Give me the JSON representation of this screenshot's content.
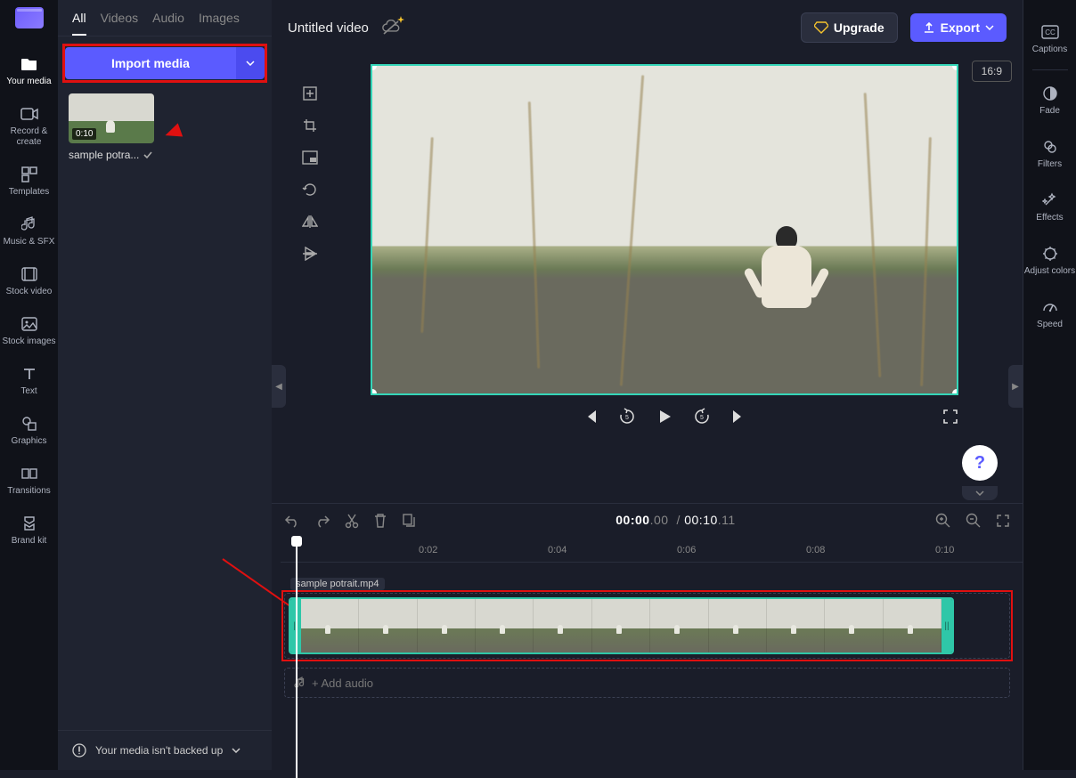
{
  "app": {
    "title": "Untitled video"
  },
  "leftRail": {
    "items": [
      {
        "label": "Your media"
      },
      {
        "label": "Record & create"
      },
      {
        "label": "Templates"
      },
      {
        "label": "Music & SFX"
      },
      {
        "label": "Stock video"
      },
      {
        "label": "Stock images"
      },
      {
        "label": "Text"
      },
      {
        "label": "Graphics"
      },
      {
        "label": "Transitions"
      },
      {
        "label": "Brand kit"
      }
    ]
  },
  "mediaPanel": {
    "tabs": {
      "all": "All",
      "videos": "Videos",
      "audio": "Audio",
      "images": "Images"
    },
    "importLabel": "Import media",
    "clip": {
      "duration": "0:10",
      "name": "sample potra..."
    },
    "backupMsg": "Your media isn't backed up"
  },
  "topbar": {
    "upgrade": "Upgrade",
    "export": "Export",
    "aspect": "16:9"
  },
  "playback": {
    "current": "00:00",
    "currentMs": ".00",
    "total": "00:10",
    "totalMs": ".11"
  },
  "timeline": {
    "ticks": [
      "0:02",
      "0:04",
      "0:06",
      "0:08",
      "0:10"
    ],
    "clipLabel": "sample potrait.mp4",
    "addAudio": "+ Add audio"
  },
  "rightRail": {
    "items": [
      {
        "label": "Captions"
      },
      {
        "label": "Fade"
      },
      {
        "label": "Filters"
      },
      {
        "label": "Effects"
      },
      {
        "label": "Adjust colors"
      },
      {
        "label": "Speed"
      }
    ]
  }
}
